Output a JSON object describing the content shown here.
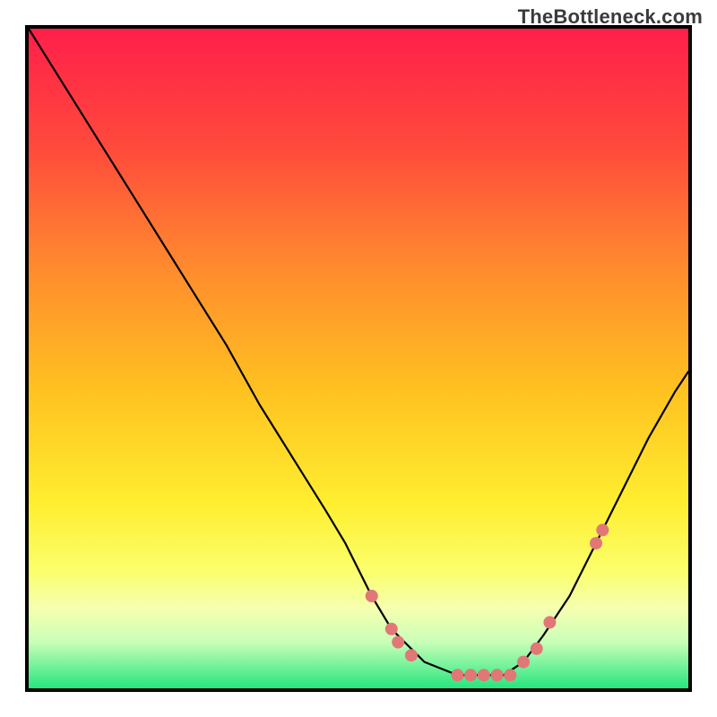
{
  "watermark": "TheBottleneck.com",
  "chart_data": {
    "type": "line",
    "xlabel": "",
    "ylabel": "",
    "xlim": [
      0,
      100
    ],
    "ylim": [
      0,
      100
    ],
    "grid": false,
    "series": [
      {
        "name": "curve",
        "x": [
          0,
          5,
          10,
          15,
          20,
          25,
          30,
          35,
          40,
          45,
          48,
          52,
          55,
          60,
          65,
          68,
          72,
          75,
          78,
          82,
          86,
          90,
          94,
          98,
          100
        ],
        "y": [
          100,
          92,
          84,
          76,
          68,
          60,
          52,
          43,
          35,
          27,
          22,
          14,
          9,
          4,
          2,
          2,
          2,
          4,
          8,
          14,
          22,
          30,
          38,
          45,
          48
        ],
        "color": "#000000",
        "width": 2.2
      }
    ],
    "markers": [
      {
        "x": 52,
        "y": 14
      },
      {
        "x": 55,
        "y": 9
      },
      {
        "x": 56,
        "y": 7
      },
      {
        "x": 58,
        "y": 5
      },
      {
        "x": 65,
        "y": 2
      },
      {
        "x": 67,
        "y": 2
      },
      {
        "x": 69,
        "y": 2
      },
      {
        "x": 71,
        "y": 2
      },
      {
        "x": 73,
        "y": 2
      },
      {
        "x": 75,
        "y": 4
      },
      {
        "x": 77,
        "y": 6
      },
      {
        "x": 79,
        "y": 10
      },
      {
        "x": 86,
        "y": 22
      },
      {
        "x": 87,
        "y": 24
      }
    ],
    "marker_color": "#e27777",
    "gradient_stops": [
      {
        "offset": 0.0,
        "color": "#ff1f4a"
      },
      {
        "offset": 0.18,
        "color": "#ff4a3c"
      },
      {
        "offset": 0.36,
        "color": "#ff8a2e"
      },
      {
        "offset": 0.55,
        "color": "#ffc220"
      },
      {
        "offset": 0.72,
        "color": "#ffee30"
      },
      {
        "offset": 0.82,
        "color": "#fbff6a"
      },
      {
        "offset": 0.88,
        "color": "#f5ffb0"
      },
      {
        "offset": 0.93,
        "color": "#c8ffb8"
      },
      {
        "offset": 1.0,
        "color": "#25e67e"
      }
    ]
  }
}
